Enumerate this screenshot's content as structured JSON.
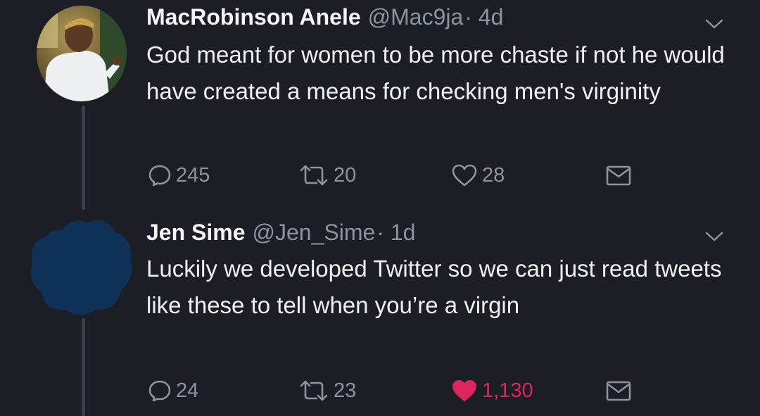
{
  "tweets": [
    {
      "display_name": "MacRobinson Anele",
      "handle": "@Mac9ja",
      "time": "· 4d",
      "text": "God meant for women to be more chaste if not he would have created a means for checking men's virginity",
      "replies": "245",
      "retweets": "20",
      "likes": "28",
      "liked": false
    },
    {
      "display_name": "Jen Sime",
      "handle": "@Jen_Sime",
      "time": "· 1d",
      "text": "Luckily we developed Twitter so we can just read tweets like these to tell when you’re a virgin",
      "replies": "24",
      "retweets": "23",
      "likes": "1,130",
      "liked": true
    }
  ],
  "colors": {
    "background": "#1c1e25",
    "secondary_text": "#8d949c",
    "like_active": "#e0245e",
    "thread_line": "#3a3e46",
    "redaction_blob": "#0f3057"
  },
  "icons": [
    "reply-icon",
    "retweet-icon",
    "like-icon",
    "share-icon",
    "chevron-down-icon"
  ]
}
